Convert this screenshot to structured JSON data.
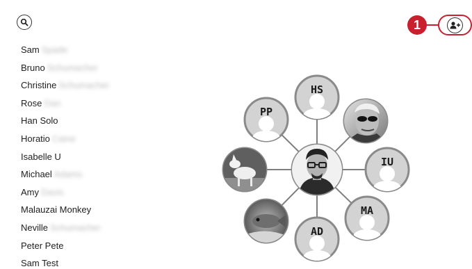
{
  "search": {
    "icon": "search-icon"
  },
  "contacts": [
    {
      "first": "Sam",
      "last": "Spade"
    },
    {
      "first": "Bruno",
      "last": "Schumacher"
    },
    {
      "first": "Christine",
      "last": "Schumacher"
    },
    {
      "first": "Rose",
      "last": "Dan"
    },
    {
      "first": "Han Solo",
      "last": ""
    },
    {
      "first": "Horatio",
      "last": "Caine"
    },
    {
      "first": "Isabelle U",
      "last": ""
    },
    {
      "first": "Michael",
      "last": "Adams"
    },
    {
      "first": "Amy",
      "last": "Davis"
    },
    {
      "first": "Malauzai Monkey",
      "last": ""
    },
    {
      "first": "Neville",
      "last": "Schumacher"
    },
    {
      "first": "Peter Pete",
      "last": ""
    },
    {
      "first": "Sam Test",
      "last": ""
    }
  ],
  "step_marker": {
    "number": "1",
    "color": "#c8202e"
  },
  "add_contact": {
    "icon": "add-user-icon"
  },
  "graph": {
    "center": {
      "kind": "cartoon-avatar"
    },
    "nodes": [
      {
        "id": "hs",
        "initials": "HS",
        "kind": "initials"
      },
      {
        "id": "photo-sunglasses",
        "initials": "",
        "kind": "photo"
      },
      {
        "id": "iu",
        "initials": "IU",
        "kind": "initials"
      },
      {
        "id": "ma",
        "initials": "MA",
        "kind": "initials"
      },
      {
        "id": "ad",
        "initials": "AD",
        "kind": "initials"
      },
      {
        "id": "photo-fish",
        "initials": "",
        "kind": "photo"
      },
      {
        "id": "photo-dog",
        "initials": "",
        "kind": "photo"
      },
      {
        "id": "pp",
        "initials": "PP",
        "kind": "initials"
      }
    ]
  }
}
